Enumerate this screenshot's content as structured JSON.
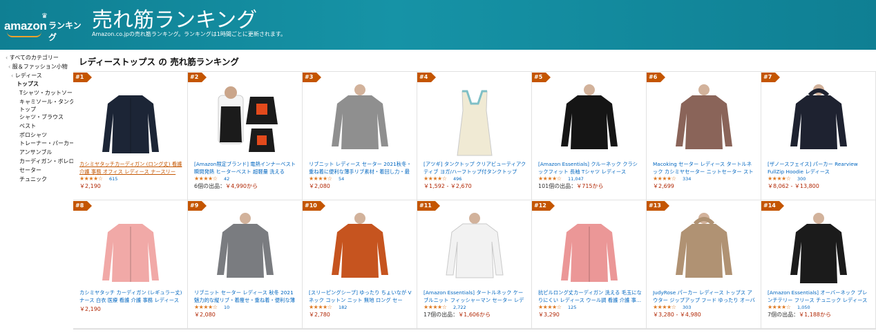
{
  "header": {
    "logo_amazon": "amazon",
    "logo_rank": "ランキング",
    "title": "売れ筋ランキング",
    "subtitle": "Amazon.co.jpの売れ筋ランキング。ランキングは1時間ごとに更新されます。"
  },
  "sidebar": {
    "items": [
      {
        "label": "すべてのカテゴリー",
        "type": "back",
        "indent": 8
      },
      {
        "label": "服＆ファッション小物",
        "type": "back",
        "indent": 12
      },
      {
        "label": "レディース",
        "type": "back",
        "indent": 16
      },
      {
        "label": "トップス",
        "type": "current"
      },
      {
        "label": "Tシャツ・カットソー",
        "type": "child"
      },
      {
        "label": "キャミソール・タンクトップ",
        "type": "wrap"
      },
      {
        "label": "シャツ・ブラウス",
        "type": "child"
      },
      {
        "label": "ベスト",
        "type": "child"
      },
      {
        "label": "ポロシャツ",
        "type": "child"
      },
      {
        "label": "トレーナー・パーカー",
        "type": "child"
      },
      {
        "label": "アンサンブル",
        "type": "child"
      },
      {
        "label": "カーディガン・ボレロ",
        "type": "child"
      },
      {
        "label": "セーター",
        "type": "child"
      },
      {
        "label": "チュニック",
        "type": "child"
      }
    ]
  },
  "main": {
    "title": "レディーストップス の 売れ筋ランキング"
  },
  "colors": {
    "accent": "#c45500",
    "link": "#0066c0",
    "price": "#b12704",
    "star": "#de7921",
    "header": "#1693a6"
  },
  "products": [
    {
      "rank": "#1",
      "title": "カシミヤタッチカーディガン (ロング丈) 看護 介護 事務 オフィス レディース ナースリー",
      "stars": "★★★★☆",
      "reviews": "615",
      "price": "￥2,190",
      "offers": "",
      "hot": true,
      "img": "cardigan-navy"
    },
    {
      "rank": "#2",
      "title": "[Amazon限定ブランド] 電熱インナーベスト 瞬間発熱 ヒーターベスト 超軽量 洗える USB…",
      "stars": "★★★★☆",
      "reviews": "42",
      "price": "￥4,990から",
      "offers": "6個の出品：",
      "hot": false,
      "img": "heated-vest"
    },
    {
      "rank": "#3",
      "title": "リブニット レディース セーター 2021秋冬・重ね着に便利な薄手リブ素材・着回し力・最強…",
      "stars": "★★★★☆",
      "reviews": "54",
      "price": "￥2,080",
      "offers": "",
      "hot": false,
      "img": "rib-knit-gray"
    },
    {
      "rank": "#4",
      "title": "[アツギ] タンクトップ クリアビューティアクティブ ヨガ/ハーフトップ付タンクトップ ス…",
      "stars": "★★★★☆",
      "reviews": "496",
      "price": "￥1,592 - ￥2,670",
      "offers": "",
      "hot": false,
      "img": "tank-top"
    },
    {
      "rank": "#5",
      "title": "[Amazon Essentials] クルーネック クラシックフィット 長袖 Tシャツ レディース",
      "stars": "★★★★☆",
      "reviews": "11,047",
      "price": "￥715から",
      "offers": "101個の出品：",
      "hot": false,
      "img": "crew-black"
    },
    {
      "rank": "#6",
      "title": "Macoking セーター レディース タートルネック カシミヤセーター ニットセーター ストレッ…",
      "stars": "★★★★☆",
      "reviews": "334",
      "price": "￥2,699",
      "offers": "",
      "hot": false,
      "img": "turtleneck-brown"
    },
    {
      "rank": "#7",
      "title": "[ザノースフェイス] パーカー Rearview FullZip Hoodie レディース",
      "stars": "★★★★☆",
      "reviews": "300",
      "price": "￥8,062 - ￥13,800",
      "offers": "",
      "hot": false,
      "img": "hoodie-navy"
    },
    {
      "rank": "#8",
      "title": "カシミヤタッチ カーディガン (レギュラー丈) ナース 白衣 医療 看護 介護 事務 レディース ナースリー",
      "stars": "",
      "reviews": "",
      "price": "￥2,190",
      "offers": "",
      "hot": false,
      "img": "cardigan-pink"
    },
    {
      "rank": "#9",
      "title": "リブニット セーター レディース 秋冬 2021魅力的な縦リブ・着痩せ・重ね着・便利な薄手…",
      "stars": "★★★★☆",
      "reviews": "10",
      "price": "￥2,080",
      "offers": "",
      "hot": false,
      "img": "turtleneck-gray"
    },
    {
      "rank": "#10",
      "title": "[スリーピングシープ] ゆったり ちょいなが Vネック コットン ニット 無地 ロング セータ…",
      "stars": "★★★★☆",
      "reviews": "182",
      "price": "￥2,780",
      "offers": "",
      "hot": false,
      "img": "vneck-orange"
    },
    {
      "rank": "#11",
      "title": "[Amazon Essentials] タートルネック ケーブルニット フィッシャーマン セーター レディ…",
      "stars": "★★★★☆",
      "reviews": "2,722",
      "price": "￥1,606から",
      "offers": "17個の出品：",
      "hot": false,
      "img": "cable-white"
    },
    {
      "rank": "#12",
      "title": "抗ピルロング丈カーディガン 洗える 毛玉になりにくい レディース ウール調 看護 介護 事…",
      "stars": "★★★★☆",
      "reviews": "125",
      "price": "￥3,290",
      "offers": "",
      "hot": false,
      "img": "cardigan-rose"
    },
    {
      "rank": "#13",
      "title": "JudyRose パーカー レディース トップス アウター ジップアップ フード ゆったり オーバー…",
      "stars": "★★★★☆",
      "reviews": "303",
      "price": "￥3,280 - ￥4,980",
      "offers": "",
      "hot": false,
      "img": "hoodie-beige"
    },
    {
      "rank": "#14",
      "title": "[Amazon Essentials] オーバーネック プレンチテリー フリース チュニック レディース",
      "stars": "★★★★☆",
      "reviews": "1,050",
      "price": "￥1,188から",
      "offers": "7個の出品：",
      "hot": false,
      "img": "tunic-black"
    }
  ]
}
